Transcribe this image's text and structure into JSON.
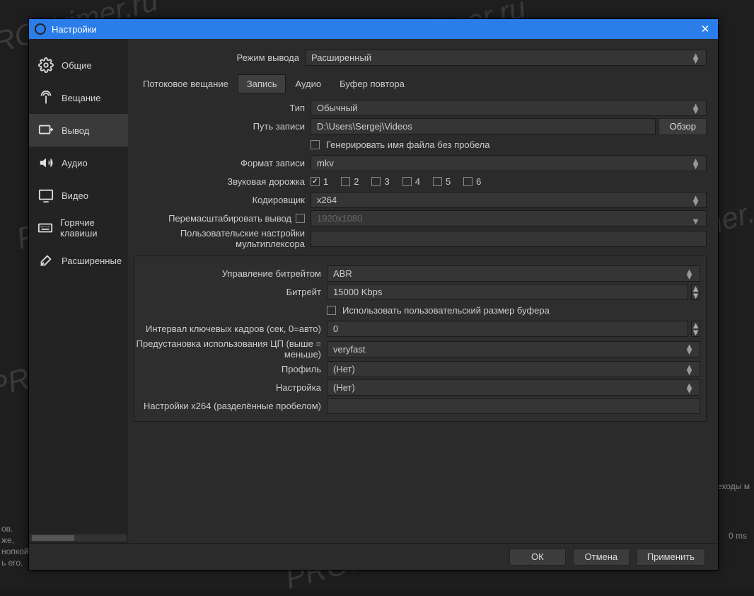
{
  "window": {
    "title": "Настройки"
  },
  "sidebar": {
    "items": [
      {
        "label": "Общие"
      },
      {
        "label": "Вещание"
      },
      {
        "label": "Вывод"
      },
      {
        "label": "Аудио"
      },
      {
        "label": "Видео"
      },
      {
        "label": "Горячие клавиши"
      },
      {
        "label": "Расширенные"
      }
    ]
  },
  "output_mode": {
    "label": "Режим вывода",
    "value": "Расширенный"
  },
  "tabs": [
    {
      "label": "Потоковое вещание"
    },
    {
      "label": "Запись"
    },
    {
      "label": "Аудио"
    },
    {
      "label": "Буфер повтора"
    }
  ],
  "rec": {
    "type_label": "Тип",
    "type_value": "Обычный",
    "path_label": "Путь записи",
    "path_value": "D:\\Users\\Sergej\\Videos",
    "browse": "Обзор",
    "nospace_label": "Генерировать имя файла без пробела",
    "format_label": "Формат записи",
    "format_value": "mkv",
    "tracks_label": "Звуковая дорожка",
    "tracks": [
      "1",
      "2",
      "3",
      "4",
      "5",
      "6"
    ],
    "encoder_label": "Кодировщик",
    "encoder_value": "x264",
    "rescale_label": "Перемасштабировать вывод",
    "rescale_value": "1920x1080",
    "mux_label": "Пользовательские настройки мультиплексора"
  },
  "enc": {
    "rc_label": "Управление битрейтом",
    "rc_value": "ABR",
    "bitrate_label": "Битрейт",
    "bitrate_value": "15000 Kbps",
    "custbuf_label": "Использовать пользовательский размер буфера",
    "keyint_label": "Интервал ключевых кадров (сек, 0=авто)",
    "keyint_value": "0",
    "preset_label": "Предустановка использования ЦП (выше = меньше)",
    "preset_value": "veryfast",
    "profile_label": "Профиль",
    "profile_value": "(Нет)",
    "tune_label": "Настройка",
    "tune_value": "(Нет)",
    "x264opts_label": "Настройки x264 (разделённые пробелом)"
  },
  "footer": {
    "ok": "ОК",
    "cancel": "Отмена",
    "apply": "Применить"
  },
  "watermarks": [
    "PROstrimer.ru",
    "PROstrimer.ru",
    "PROstrimer.ru",
    "PROstrimer.ru",
    "PROstrimer.ru",
    "PROstrimer.ru",
    "PROstrimer.ru",
    "PROstrimer.ru"
  ],
  "bg": {
    "transitions": "реходы м",
    "ms": "0 ms",
    "frag1": "ов.",
    "frag2": "же,",
    "frag3": "нопкой",
    "frag4": "ь его."
  }
}
